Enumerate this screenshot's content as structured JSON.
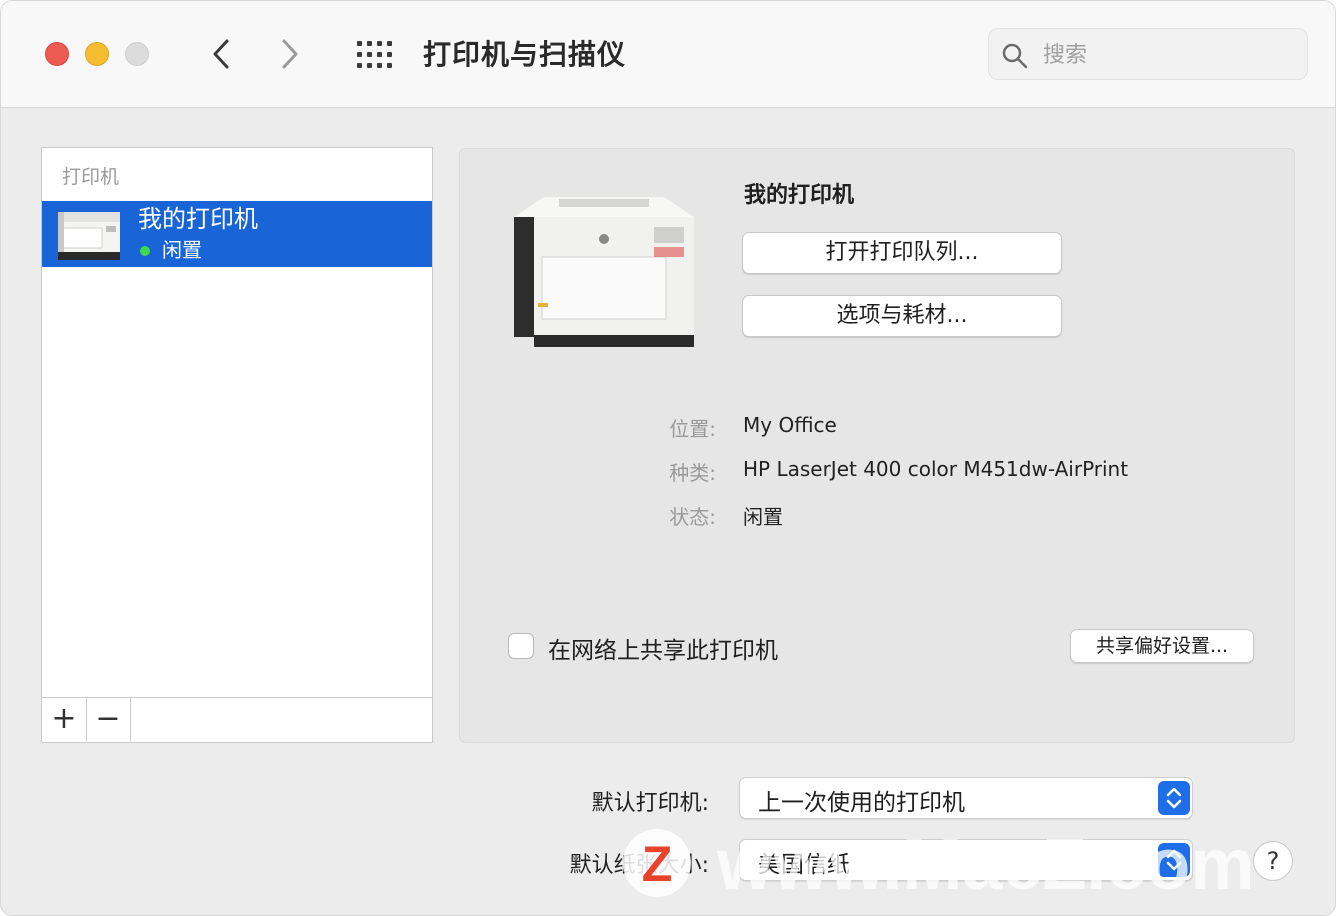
{
  "window": {
    "title": "打印机与扫描仪",
    "search_placeholder": "搜索"
  },
  "sidebar": {
    "header": "打印机",
    "items": [
      {
        "name": "我的打印机",
        "status": "闲置",
        "status_color": "#3fd94c"
      }
    ],
    "add_label": "+",
    "remove_label": "−"
  },
  "detail": {
    "name": "我的打印机",
    "open_queue_label": "打开打印队列...",
    "options_label": "选项与耗材...",
    "info": [
      {
        "label": "位置:",
        "value": "My Office"
      },
      {
        "label": "种类:",
        "value": "HP LaserJet 400 color M451dw-AirPrint"
      },
      {
        "label": "状态:",
        "value": "闲置"
      }
    ],
    "share_label": "在网络上共享此打印机",
    "share_checked": false,
    "share_prefs_label": "共享偏好设置..."
  },
  "settings": {
    "default_printer_label": "默认打印机:",
    "default_printer_value": "上一次使用的打印机",
    "default_paper_label": "默认纸张大小:",
    "default_paper_value": "美国信纸"
  },
  "help_label": "?",
  "watermark": {
    "text": "www.MacZ.com",
    "logo_letter": "Z"
  },
  "colors": {
    "selection": "#1965d8",
    "accent": "#1d6ee8",
    "close": "#ee5b52",
    "minimize": "#f6bc2f",
    "watermark_logo": "#e8412c"
  }
}
